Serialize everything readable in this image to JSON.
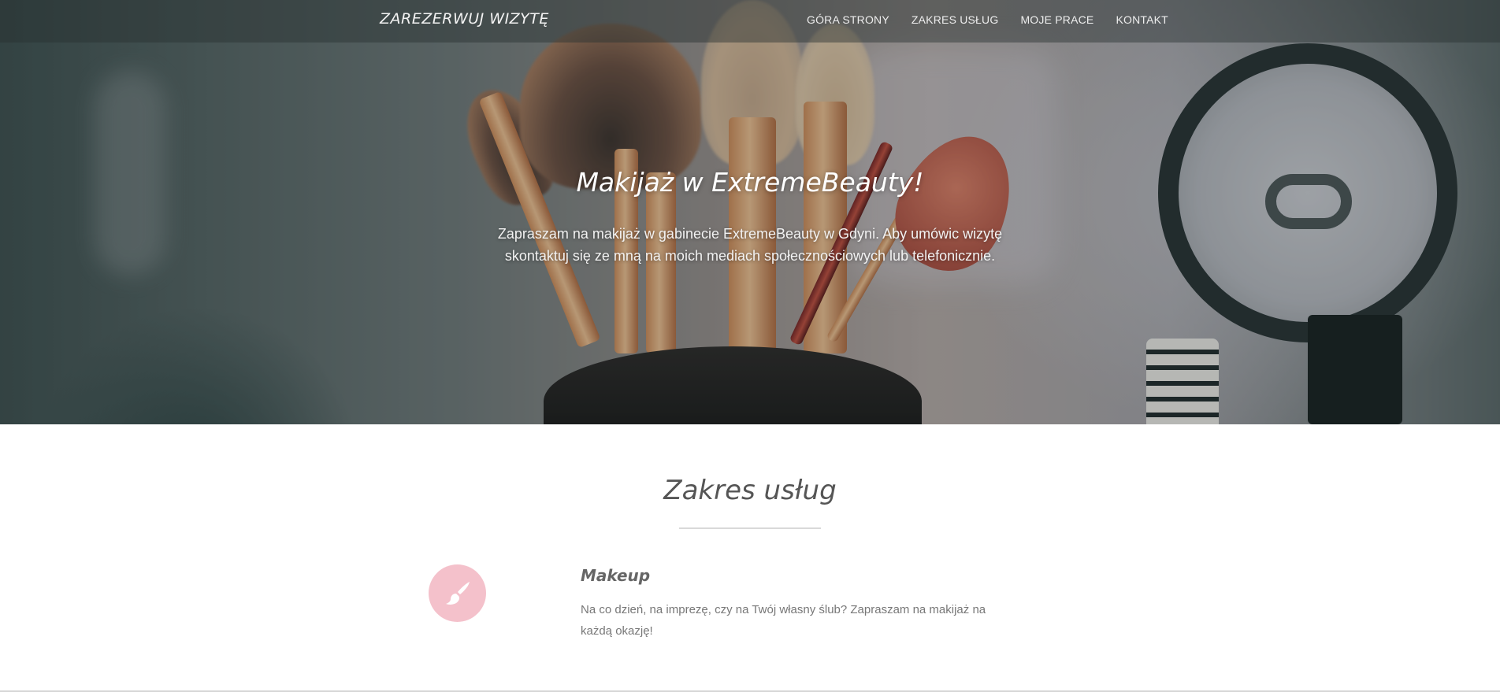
{
  "navbar": {
    "brand": "ZAREZERWUJ WIZYTĘ",
    "links": [
      {
        "label": "GÓRA STRONY"
      },
      {
        "label": "ZAKRES USŁUG"
      },
      {
        "label": "MOJE PRACE"
      },
      {
        "label": "KONTAKT"
      }
    ]
  },
  "hero": {
    "title": "Makijaż w ExtremeBeauty!",
    "text": "Zapraszam na makijaż w gabinecie ExtremeBeauty w Gdyni. Aby umówic wizytę skontaktuj się ze mną na moich mediach społecznościowych lub telefonicznie."
  },
  "services": {
    "title": "Zakres usług",
    "items": [
      {
        "icon": "brush-icon",
        "title": "Makeup",
        "description": "Na co dzień, na imprezę, czy na Twój własny ślub? Zapraszam na makijaż na każdą okazję!"
      }
    ]
  },
  "colors": {
    "accent_pink": "#f4c1cb",
    "text_gray": "#777777"
  }
}
